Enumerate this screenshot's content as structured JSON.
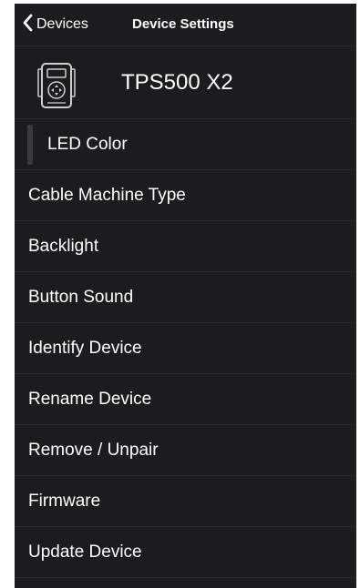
{
  "nav": {
    "back_label": "Devices",
    "title": "Device Settings",
    "back_icon": "chevron-left-icon"
  },
  "device": {
    "name": "TPS500 X2",
    "icon": "remote-control-device-icon"
  },
  "menu": {
    "items": [
      {
        "label": "LED Color",
        "selected": true
      },
      {
        "label": "Cable Machine Type"
      },
      {
        "label": "Backlight"
      },
      {
        "label": "Button Sound"
      },
      {
        "label": "Identify Device"
      },
      {
        "label": "Rename Device"
      },
      {
        "label": "Remove / Unpair"
      },
      {
        "label": "Firmware"
      },
      {
        "label": "Update Device"
      }
    ]
  },
  "colors": {
    "background": "#1c1c1e",
    "separator": "#2c2c2e",
    "text": "#ffffff",
    "selection_bar": "#3a3a3c"
  }
}
